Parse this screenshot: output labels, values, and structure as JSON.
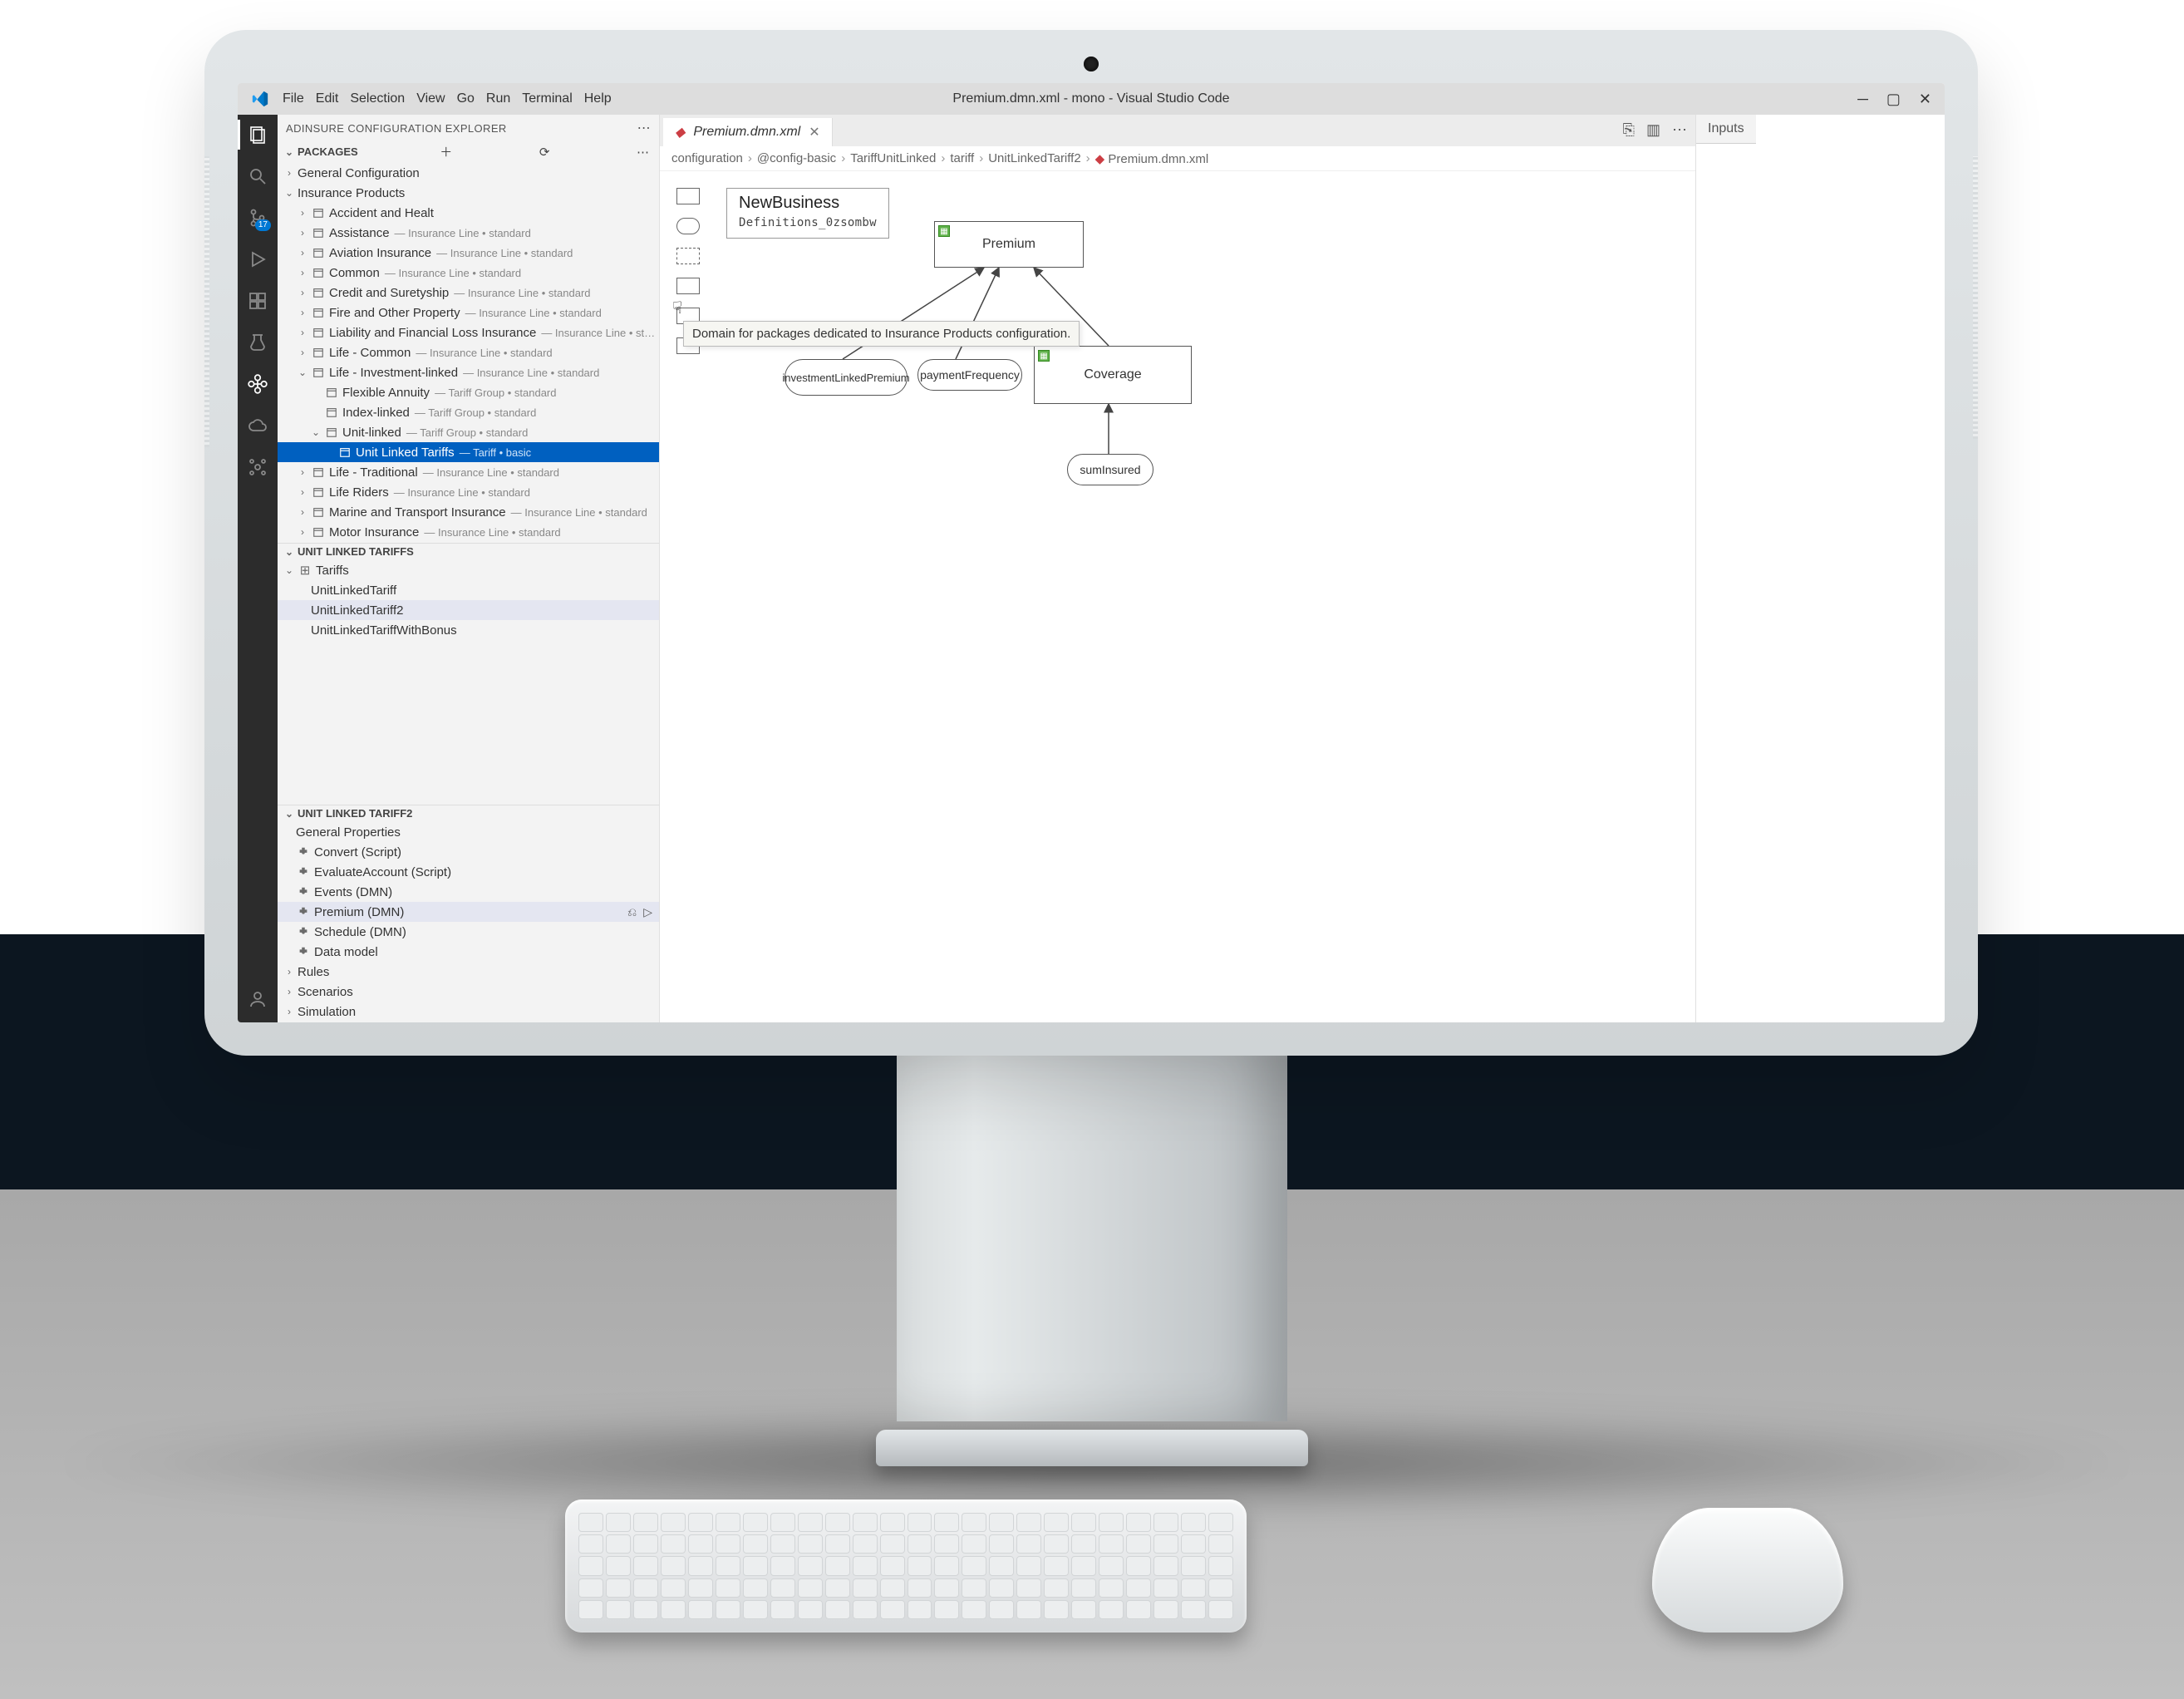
{
  "window_title": "Premium.dmn.xml - mono - Visual Studio Code",
  "menu": [
    "File",
    "Edit",
    "Selection",
    "View",
    "Go",
    "Run",
    "Terminal",
    "Help"
  ],
  "sidebar_title": "ADINSURE CONFIGURATION EXPLORER",
  "sections": {
    "packages": "PACKAGES",
    "ult": "UNIT LINKED TARIFFS",
    "ult2": "UNIT LINKED TARIFF2"
  },
  "tooltip": "Domain for packages dedicated to Insurance Products configuration.",
  "packages": {
    "general": {
      "label": "General Configuration"
    },
    "insurance": {
      "label": "Insurance Products"
    },
    "items": [
      {
        "label": "Accident and Healt",
        "meta": ""
      },
      {
        "label": "Assistance",
        "meta": "—  Insurance Line  •  standard"
      },
      {
        "label": "Aviation Insurance",
        "meta": "—  Insurance Line  •  standard"
      },
      {
        "label": "Common",
        "meta": "—  Insurance Line  •  standard"
      },
      {
        "label": "Credit and Suretyship",
        "meta": "—  Insurance Line  •  standard"
      },
      {
        "label": "Fire and Other Property",
        "meta": "—  Insurance Line  •  standard"
      },
      {
        "label": "Liability and Financial Loss Insurance",
        "meta": "—  Insurance Line  •  st…"
      },
      {
        "label": "Life - Common",
        "meta": "—  Insurance Line  •  standard"
      },
      {
        "label": "Life - Investment-linked",
        "meta": "—  Insurance Line  •  standard",
        "children": [
          {
            "label": "Flexible Annuity",
            "meta": "—  Tariff Group  •  standard"
          },
          {
            "label": "Index-linked",
            "meta": "—  Tariff Group  •  standard"
          },
          {
            "label": "Unit-linked",
            "meta": "—  Tariff Group  •  standard",
            "children": [
              {
                "label": "Unit Linked Tariffs",
                "meta": "—  Tariff  •  basic",
                "sel": true
              }
            ]
          }
        ]
      },
      {
        "label": "Life - Traditional",
        "meta": "—  Insurance Line  •  standard"
      },
      {
        "label": "Life Riders",
        "meta": "—  Insurance Line  •  standard"
      },
      {
        "label": "Marine and Transport Insurance",
        "meta": "—  Insurance Line  •  standard"
      },
      {
        "label": "Motor Insurance",
        "meta": "—  Insurance Line  •  standard"
      }
    ]
  },
  "ult_items": {
    "parent": "Tariffs",
    "children": [
      "UnitLinkedTariff",
      "UnitLinkedTariff2",
      "UnitLinkedTariffWithBonus"
    ],
    "hl_index": 1
  },
  "ult2_items": [
    {
      "label": "General Properties",
      "kind": "plain"
    },
    {
      "label": "Convert (Script)",
      "kind": "puzzle"
    },
    {
      "label": "EvaluateAccount (Script)",
      "kind": "puzzle"
    },
    {
      "label": "Events (DMN)",
      "kind": "puzzle"
    },
    {
      "label": "Premium (DMN)",
      "kind": "puzzle",
      "hl": true,
      "acts": true
    },
    {
      "label": "Schedule (DMN)",
      "kind": "puzzle"
    },
    {
      "label": "Data model",
      "kind": "puzzle"
    },
    {
      "label": "Rules",
      "kind": "chev"
    },
    {
      "label": "Scenarios",
      "kind": "chev"
    },
    {
      "label": "Simulation",
      "kind": "chev"
    }
  ],
  "tab": {
    "label": "Premium.dmn.xml"
  },
  "breadcrumbs": [
    "configuration",
    "@config-basic",
    "TariffUnitLinked",
    "tariff",
    "UnitLinkedTariff2",
    "Premium.dmn.xml"
  ],
  "defs": {
    "title": "NewBusiness",
    "sub": "Definitions_0zsombw"
  },
  "nodes": {
    "premium": "Premium",
    "coverage": "Coverage",
    "invest": "investmentLinkedPremium",
    "payfreq": "paymentFrequency",
    "sum": "sumInsured"
  },
  "right_tab": "Inputs",
  "source_badge": "17"
}
